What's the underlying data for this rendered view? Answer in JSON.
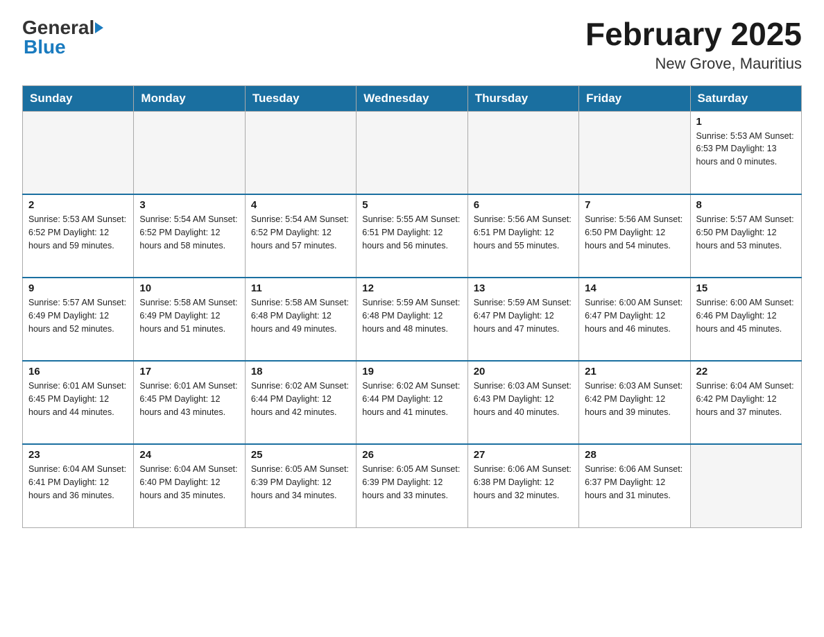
{
  "header": {
    "logo_general": "General",
    "logo_blue": "Blue",
    "title": "February 2025",
    "subtitle": "New Grove, Mauritius"
  },
  "days_of_week": [
    "Sunday",
    "Monday",
    "Tuesday",
    "Wednesday",
    "Thursday",
    "Friday",
    "Saturday"
  ],
  "weeks": [
    {
      "days": [
        {
          "num": "",
          "info": ""
        },
        {
          "num": "",
          "info": ""
        },
        {
          "num": "",
          "info": ""
        },
        {
          "num": "",
          "info": ""
        },
        {
          "num": "",
          "info": ""
        },
        {
          "num": "",
          "info": ""
        },
        {
          "num": "1",
          "info": "Sunrise: 5:53 AM\nSunset: 6:53 PM\nDaylight: 13 hours and 0 minutes."
        }
      ]
    },
    {
      "days": [
        {
          "num": "2",
          "info": "Sunrise: 5:53 AM\nSunset: 6:52 PM\nDaylight: 12 hours and 59 minutes."
        },
        {
          "num": "3",
          "info": "Sunrise: 5:54 AM\nSunset: 6:52 PM\nDaylight: 12 hours and 58 minutes."
        },
        {
          "num": "4",
          "info": "Sunrise: 5:54 AM\nSunset: 6:52 PM\nDaylight: 12 hours and 57 minutes."
        },
        {
          "num": "5",
          "info": "Sunrise: 5:55 AM\nSunset: 6:51 PM\nDaylight: 12 hours and 56 minutes."
        },
        {
          "num": "6",
          "info": "Sunrise: 5:56 AM\nSunset: 6:51 PM\nDaylight: 12 hours and 55 minutes."
        },
        {
          "num": "7",
          "info": "Sunrise: 5:56 AM\nSunset: 6:50 PM\nDaylight: 12 hours and 54 minutes."
        },
        {
          "num": "8",
          "info": "Sunrise: 5:57 AM\nSunset: 6:50 PM\nDaylight: 12 hours and 53 minutes."
        }
      ]
    },
    {
      "days": [
        {
          "num": "9",
          "info": "Sunrise: 5:57 AM\nSunset: 6:49 PM\nDaylight: 12 hours and 52 minutes."
        },
        {
          "num": "10",
          "info": "Sunrise: 5:58 AM\nSunset: 6:49 PM\nDaylight: 12 hours and 51 minutes."
        },
        {
          "num": "11",
          "info": "Sunrise: 5:58 AM\nSunset: 6:48 PM\nDaylight: 12 hours and 49 minutes."
        },
        {
          "num": "12",
          "info": "Sunrise: 5:59 AM\nSunset: 6:48 PM\nDaylight: 12 hours and 48 minutes."
        },
        {
          "num": "13",
          "info": "Sunrise: 5:59 AM\nSunset: 6:47 PM\nDaylight: 12 hours and 47 minutes."
        },
        {
          "num": "14",
          "info": "Sunrise: 6:00 AM\nSunset: 6:47 PM\nDaylight: 12 hours and 46 minutes."
        },
        {
          "num": "15",
          "info": "Sunrise: 6:00 AM\nSunset: 6:46 PM\nDaylight: 12 hours and 45 minutes."
        }
      ]
    },
    {
      "days": [
        {
          "num": "16",
          "info": "Sunrise: 6:01 AM\nSunset: 6:45 PM\nDaylight: 12 hours and 44 minutes."
        },
        {
          "num": "17",
          "info": "Sunrise: 6:01 AM\nSunset: 6:45 PM\nDaylight: 12 hours and 43 minutes."
        },
        {
          "num": "18",
          "info": "Sunrise: 6:02 AM\nSunset: 6:44 PM\nDaylight: 12 hours and 42 minutes."
        },
        {
          "num": "19",
          "info": "Sunrise: 6:02 AM\nSunset: 6:44 PM\nDaylight: 12 hours and 41 minutes."
        },
        {
          "num": "20",
          "info": "Sunrise: 6:03 AM\nSunset: 6:43 PM\nDaylight: 12 hours and 40 minutes."
        },
        {
          "num": "21",
          "info": "Sunrise: 6:03 AM\nSunset: 6:42 PM\nDaylight: 12 hours and 39 minutes."
        },
        {
          "num": "22",
          "info": "Sunrise: 6:04 AM\nSunset: 6:42 PM\nDaylight: 12 hours and 37 minutes."
        }
      ]
    },
    {
      "days": [
        {
          "num": "23",
          "info": "Sunrise: 6:04 AM\nSunset: 6:41 PM\nDaylight: 12 hours and 36 minutes."
        },
        {
          "num": "24",
          "info": "Sunrise: 6:04 AM\nSunset: 6:40 PM\nDaylight: 12 hours and 35 minutes."
        },
        {
          "num": "25",
          "info": "Sunrise: 6:05 AM\nSunset: 6:39 PM\nDaylight: 12 hours and 34 minutes."
        },
        {
          "num": "26",
          "info": "Sunrise: 6:05 AM\nSunset: 6:39 PM\nDaylight: 12 hours and 33 minutes."
        },
        {
          "num": "27",
          "info": "Sunrise: 6:06 AM\nSunset: 6:38 PM\nDaylight: 12 hours and 32 minutes."
        },
        {
          "num": "28",
          "info": "Sunrise: 6:06 AM\nSunset: 6:37 PM\nDaylight: 12 hours and 31 minutes."
        },
        {
          "num": "",
          "info": ""
        }
      ]
    }
  ]
}
